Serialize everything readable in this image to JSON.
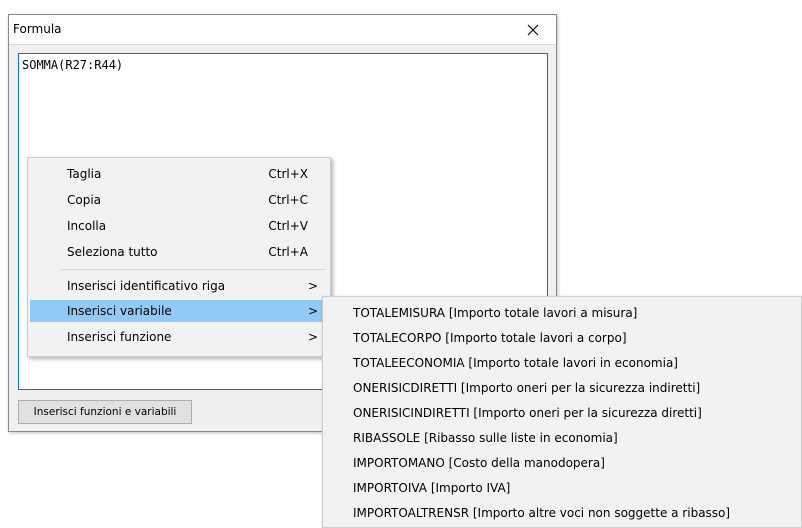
{
  "dialog": {
    "title": "Formula",
    "formula_text": "SOMMA(R27:R44)",
    "insert_button_label": "Inserisci funzioni e variabili"
  },
  "context_menu": {
    "items": [
      {
        "label": "Taglia",
        "shortcut": "Ctrl+X"
      },
      {
        "label": "Copia",
        "shortcut": "Ctrl+C"
      },
      {
        "label": "Incolla",
        "shortcut": "Ctrl+V"
      },
      {
        "label": "Seleziona tutto",
        "shortcut": "Ctrl+A"
      }
    ],
    "submenus": [
      {
        "label": "Inserisci identificativo riga",
        "arrow": ">"
      },
      {
        "label": "Inserisci variabile",
        "arrow": ">",
        "highlighted": true
      },
      {
        "label": "Inserisci funzione",
        "arrow": ">"
      }
    ]
  },
  "variables_submenu": {
    "items": [
      "TOTALEMISURA [Importo totale lavori a misura]",
      "TOTALECORPO [Importo totale lavori a corpo]",
      "TOTALEECONOMIA [Importo totale lavori in economia]",
      "ONERISICDIRETTI [Importo oneri per la sicurezza indiretti]",
      "ONERISICINDIRETTI [Importo oneri per la sicurezza diretti]",
      "RIBASSOLE [Ribasso sulle liste in economia]",
      "IMPORTOMANO [Costo della manodopera]",
      "IMPORTOIVA [Importo IVA]",
      "IMPORTOALTRENSR [Importo altre voci non soggette a ribasso]"
    ]
  },
  "colors": {
    "highlight": "#91c9f7",
    "focus_border": "#0078d7"
  }
}
